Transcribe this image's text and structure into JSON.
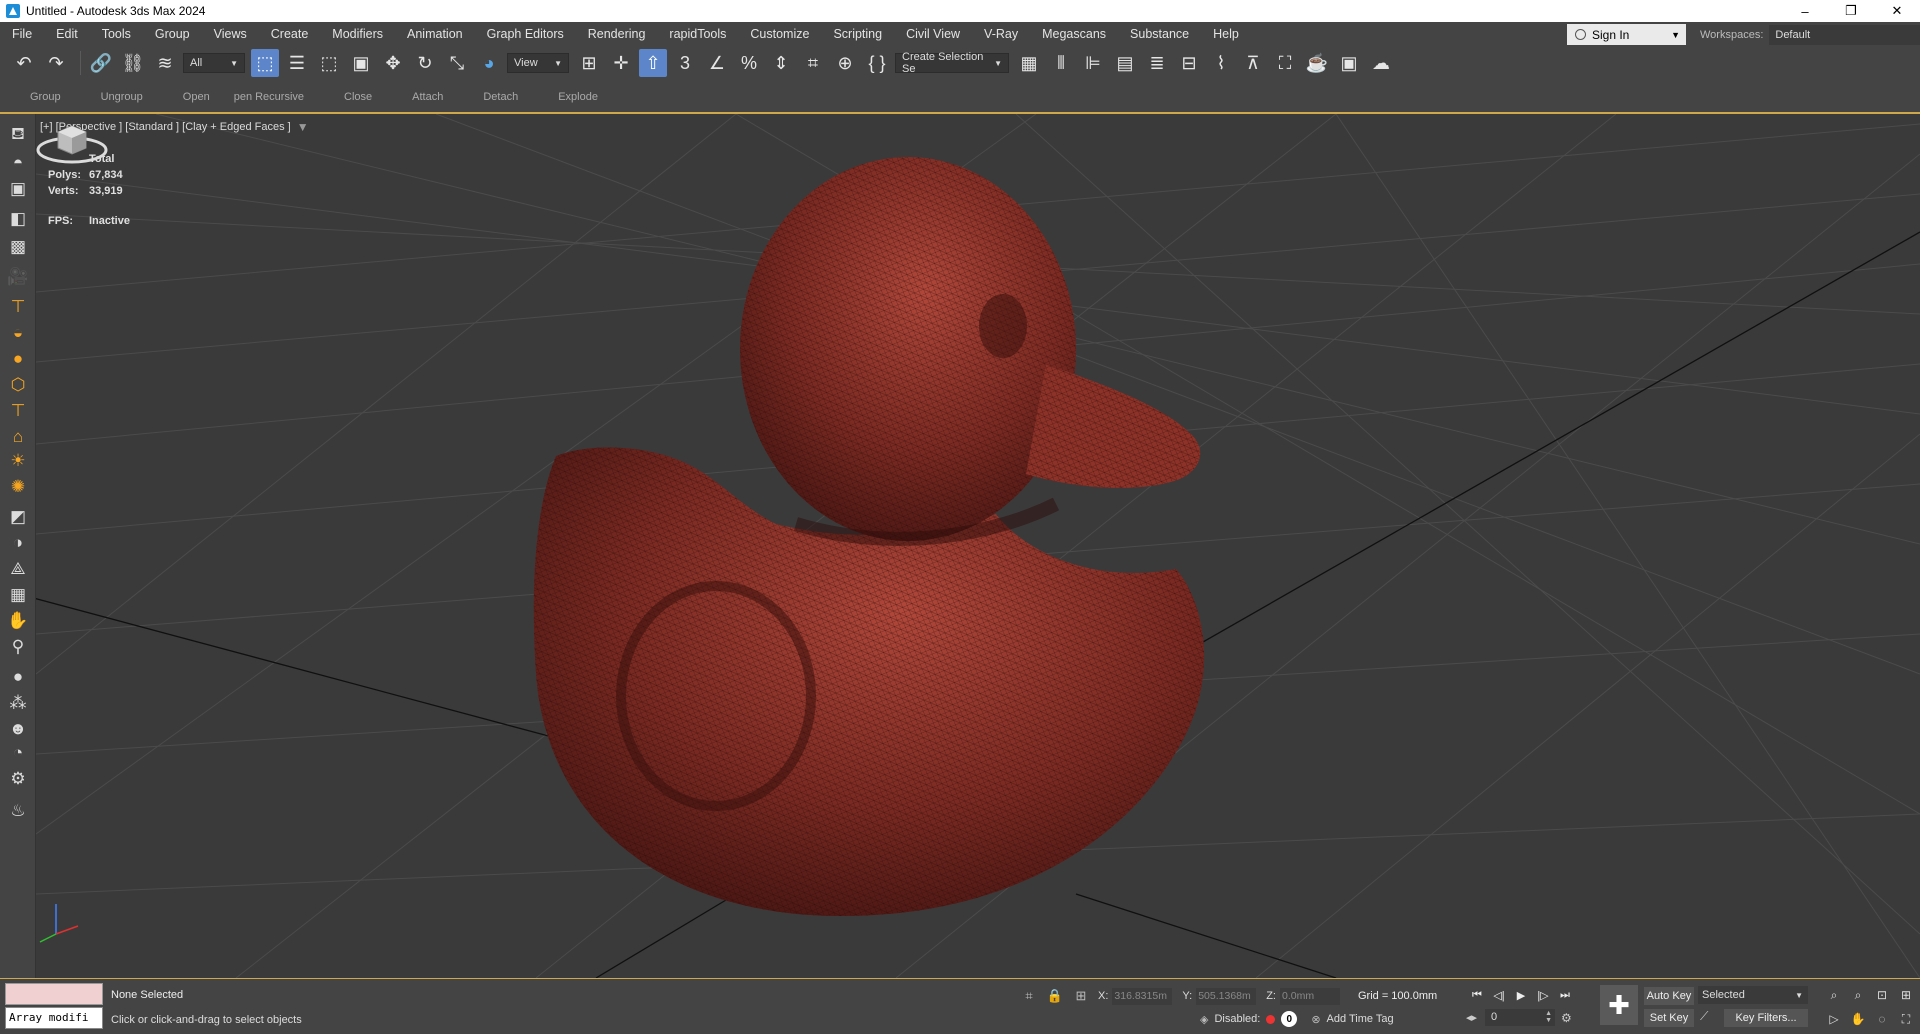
{
  "window": {
    "title": "Untitled - Autodesk 3ds Max 2024",
    "minimize_glyph": "–",
    "restore_glyph": "❐",
    "close_glyph": "✕"
  },
  "menu": {
    "items": [
      "File",
      "Edit",
      "Tools",
      "Group",
      "Views",
      "Create",
      "Modifiers",
      "Animation",
      "Graph Editors",
      "Rendering",
      "rapidTools",
      "Customize",
      "Scripting",
      "Civil View",
      "V-Ray",
      "Megascans",
      "Substance",
      "Help"
    ],
    "sign_in": "Sign In",
    "workspaces_label": "Workspaces:",
    "workspace_value": "Default"
  },
  "toolbar": {
    "selection_filter": "All",
    "reference_coord": "View",
    "named_selection": "Create Selection Se"
  },
  "ribbon": {
    "items": [
      "Group",
      "Ungroup",
      "Open",
      "pen Recursive",
      "Close",
      "Attach",
      "Detach",
      "Explode"
    ]
  },
  "viewport": {
    "label": "[+] [Perspective ] [Standard ] [Clay + Edged Faces ]",
    "stats_total": "Total",
    "polys_label": "Polys:",
    "polys_value": "67,834",
    "verts_label": "Verts:",
    "verts_value": "33,919",
    "fps_label": "FPS:",
    "fps_value": "Inactive",
    "mesh_color": "#7a2a22",
    "background_color": "#3a3a3a"
  },
  "status": {
    "script_text": "Array modifi",
    "selection": "None Selected",
    "prompt": "Click or click-and-drag to select objects",
    "x_label": "X:",
    "x_value": "316.8315m",
    "y_label": "Y:",
    "y_value": "505.1368m",
    "z_label": "Z:",
    "z_value": "0.0mm",
    "grid": "Grid = 100.0mm",
    "disabled_label": "Disabled:",
    "disabled_count": "0",
    "add_time_tag": "Add Time Tag",
    "frame_value": "0",
    "auto_key": "Auto Key",
    "set_key": "Set Key",
    "selected_set": "Selected",
    "key_filters": "Key Filters..."
  },
  "colors": {
    "accent_border": "#cfa84a",
    "active_tool": "#5c86c9",
    "ui_background": "#444444"
  }
}
